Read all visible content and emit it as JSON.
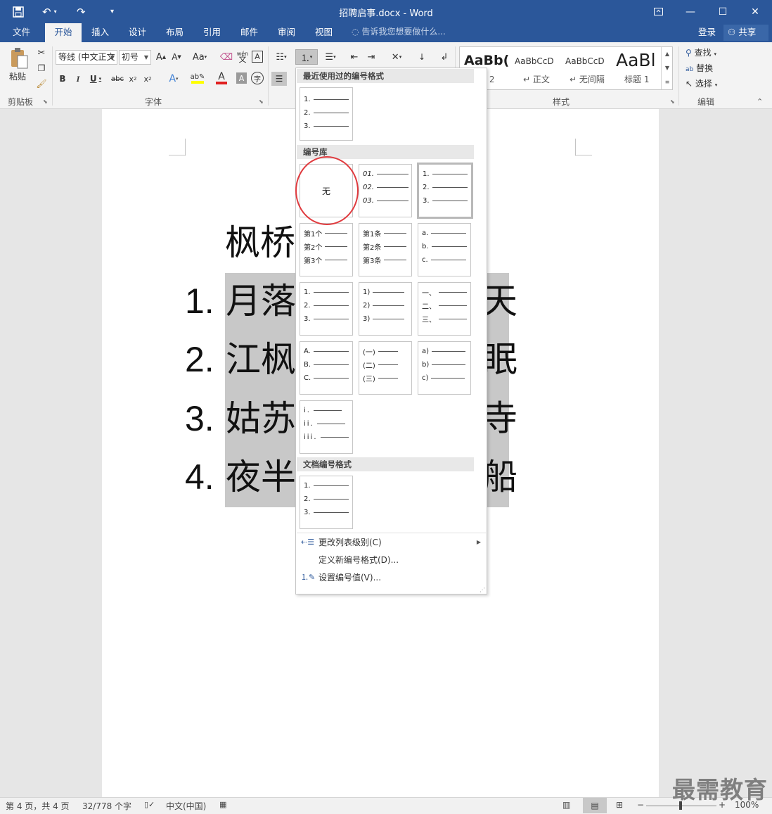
{
  "window": {
    "title": "招聘启事.docx - Word",
    "controls": {
      "restore_icon": "ribbon-display-icon",
      "minimize": "—",
      "maximize": "☐",
      "close": "✕"
    }
  },
  "tabs": [
    "文件",
    "开始",
    "插入",
    "设计",
    "布局",
    "引用",
    "邮件",
    "审阅",
    "视图"
  ],
  "active_tab": "开始",
  "tell_me": "告诉我您想要做什么...",
  "account": {
    "login": "登录",
    "share": "共享"
  },
  "ribbon": {
    "clipboard": {
      "paste": "粘贴",
      "label": "剪贴板"
    },
    "font": {
      "name": "等线 (中文正文",
      "size": "初号",
      "label": "字体",
      "wen": "wén",
      "wen_char": "文"
    },
    "styles": {
      "items": [
        {
          "preview": "AaBb(",
          "name": "标题 2"
        },
        {
          "preview": "AaBbCcD",
          "name": "正文"
        },
        {
          "preview": "AaBbCcD",
          "name": "无间隔"
        },
        {
          "preview": "AaBl",
          "name": "标题 1"
        }
      ],
      "label": "样式"
    },
    "editing": {
      "find": "查找",
      "replace": "替换",
      "select": "选择",
      "label": "编辑"
    }
  },
  "document": {
    "title_line": "枫桥",
    "lines": [
      {
        "num": "1.",
        "first": "月落",
        "last": "天"
      },
      {
        "num": "2.",
        "first": "江枫",
        "last": "眠"
      },
      {
        "num": "3.",
        "first": "姑苏",
        "last": "寺"
      },
      {
        "num": "4.",
        "first": "夜半",
        "last": "船"
      }
    ]
  },
  "numbering_menu": {
    "recent_header": "最近使用过的编号格式",
    "library_header": "编号库",
    "none_label": "无",
    "document_header": "文档编号格式",
    "recent": [
      [
        "1.",
        "2.",
        "3."
      ]
    ],
    "library": [
      [
        "01.",
        "02.",
        "03."
      ],
      [
        "1.",
        "2.",
        "3."
      ],
      [
        "第1个",
        "第2个",
        "第3个"
      ],
      [
        "第1条",
        "第2条",
        "第3条"
      ],
      [
        "a.",
        "b.",
        "c."
      ],
      [
        "1.",
        "2.",
        "3."
      ],
      [
        "1)",
        "2)",
        "3)"
      ],
      [
        "一、",
        "二、",
        "三、"
      ],
      [
        "A.",
        "B.",
        "C."
      ],
      [
        "(一)",
        "(二)",
        "(三)"
      ],
      [
        "a)",
        "b)",
        "c)"
      ],
      [
        "i.",
        "ii.",
        "iii."
      ]
    ],
    "document": [
      [
        "1.",
        "2.",
        "3."
      ]
    ],
    "actions": [
      {
        "label": "更改列表级别(C)",
        "submenu": true
      },
      {
        "label": "定义新编号格式(D)...",
        "submenu": false
      },
      {
        "label": "设置编号值(V)...",
        "submenu": false
      }
    ]
  },
  "status": {
    "page": "第 4 页，共 4 页",
    "words": "32/778 个字",
    "language": "中文(中国)",
    "zoom": "100%"
  },
  "watermark": "最需教育",
  "colors": {
    "accent": "#2b579a",
    "annotation": "#e03a3e",
    "selection": "#c8c8c8"
  }
}
